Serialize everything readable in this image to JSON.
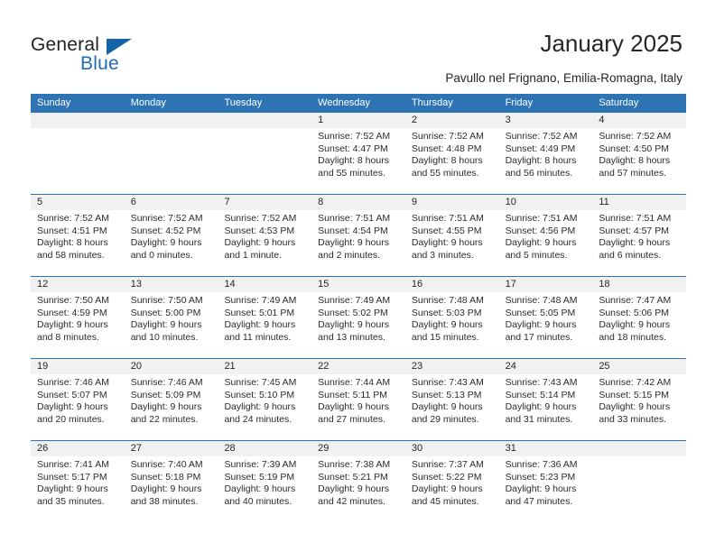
{
  "brand": {
    "name_part1": "General",
    "name_part2": "Blue",
    "accent_color": "#1464a8"
  },
  "header": {
    "title": "January 2025",
    "subtitle": "Pavullo nel Frignano, Emilia-Romagna, Italy",
    "header_bg_color": "#2e74b5"
  },
  "calendar": {
    "weekday_headers": [
      "Sunday",
      "Monday",
      "Tuesday",
      "Wednesday",
      "Thursday",
      "Friday",
      "Saturday"
    ],
    "weeks": [
      [
        {
          "day": "",
          "lines": []
        },
        {
          "day": "",
          "lines": []
        },
        {
          "day": "",
          "lines": []
        },
        {
          "day": "1",
          "lines": [
            "Sunrise: 7:52 AM",
            "Sunset: 4:47 PM",
            "Daylight: 8 hours",
            "and 55 minutes."
          ]
        },
        {
          "day": "2",
          "lines": [
            "Sunrise: 7:52 AM",
            "Sunset: 4:48 PM",
            "Daylight: 8 hours",
            "and 55 minutes."
          ]
        },
        {
          "day": "3",
          "lines": [
            "Sunrise: 7:52 AM",
            "Sunset: 4:49 PM",
            "Daylight: 8 hours",
            "and 56 minutes."
          ]
        },
        {
          "day": "4",
          "lines": [
            "Sunrise: 7:52 AM",
            "Sunset: 4:50 PM",
            "Daylight: 8 hours",
            "and 57 minutes."
          ]
        }
      ],
      [
        {
          "day": "5",
          "lines": [
            "Sunrise: 7:52 AM",
            "Sunset: 4:51 PM",
            "Daylight: 8 hours",
            "and 58 minutes."
          ]
        },
        {
          "day": "6",
          "lines": [
            "Sunrise: 7:52 AM",
            "Sunset: 4:52 PM",
            "Daylight: 9 hours",
            "and 0 minutes."
          ]
        },
        {
          "day": "7",
          "lines": [
            "Sunrise: 7:52 AM",
            "Sunset: 4:53 PM",
            "Daylight: 9 hours",
            "and 1 minute."
          ]
        },
        {
          "day": "8",
          "lines": [
            "Sunrise: 7:51 AM",
            "Sunset: 4:54 PM",
            "Daylight: 9 hours",
            "and 2 minutes."
          ]
        },
        {
          "day": "9",
          "lines": [
            "Sunrise: 7:51 AM",
            "Sunset: 4:55 PM",
            "Daylight: 9 hours",
            "and 3 minutes."
          ]
        },
        {
          "day": "10",
          "lines": [
            "Sunrise: 7:51 AM",
            "Sunset: 4:56 PM",
            "Daylight: 9 hours",
            "and 5 minutes."
          ]
        },
        {
          "day": "11",
          "lines": [
            "Sunrise: 7:51 AM",
            "Sunset: 4:57 PM",
            "Daylight: 9 hours",
            "and 6 minutes."
          ]
        }
      ],
      [
        {
          "day": "12",
          "lines": [
            "Sunrise: 7:50 AM",
            "Sunset: 4:59 PM",
            "Daylight: 9 hours",
            "and 8 minutes."
          ]
        },
        {
          "day": "13",
          "lines": [
            "Sunrise: 7:50 AM",
            "Sunset: 5:00 PM",
            "Daylight: 9 hours",
            "and 10 minutes."
          ]
        },
        {
          "day": "14",
          "lines": [
            "Sunrise: 7:49 AM",
            "Sunset: 5:01 PM",
            "Daylight: 9 hours",
            "and 11 minutes."
          ]
        },
        {
          "day": "15",
          "lines": [
            "Sunrise: 7:49 AM",
            "Sunset: 5:02 PM",
            "Daylight: 9 hours",
            "and 13 minutes."
          ]
        },
        {
          "day": "16",
          "lines": [
            "Sunrise: 7:48 AM",
            "Sunset: 5:03 PM",
            "Daylight: 9 hours",
            "and 15 minutes."
          ]
        },
        {
          "day": "17",
          "lines": [
            "Sunrise: 7:48 AM",
            "Sunset: 5:05 PM",
            "Daylight: 9 hours",
            "and 17 minutes."
          ]
        },
        {
          "day": "18",
          "lines": [
            "Sunrise: 7:47 AM",
            "Sunset: 5:06 PM",
            "Daylight: 9 hours",
            "and 18 minutes."
          ]
        }
      ],
      [
        {
          "day": "19",
          "lines": [
            "Sunrise: 7:46 AM",
            "Sunset: 5:07 PM",
            "Daylight: 9 hours",
            "and 20 minutes."
          ]
        },
        {
          "day": "20",
          "lines": [
            "Sunrise: 7:46 AM",
            "Sunset: 5:09 PM",
            "Daylight: 9 hours",
            "and 22 minutes."
          ]
        },
        {
          "day": "21",
          "lines": [
            "Sunrise: 7:45 AM",
            "Sunset: 5:10 PM",
            "Daylight: 9 hours",
            "and 24 minutes."
          ]
        },
        {
          "day": "22",
          "lines": [
            "Sunrise: 7:44 AM",
            "Sunset: 5:11 PM",
            "Daylight: 9 hours",
            "and 27 minutes."
          ]
        },
        {
          "day": "23",
          "lines": [
            "Sunrise: 7:43 AM",
            "Sunset: 5:13 PM",
            "Daylight: 9 hours",
            "and 29 minutes."
          ]
        },
        {
          "day": "24",
          "lines": [
            "Sunrise: 7:43 AM",
            "Sunset: 5:14 PM",
            "Daylight: 9 hours",
            "and 31 minutes."
          ]
        },
        {
          "day": "25",
          "lines": [
            "Sunrise: 7:42 AM",
            "Sunset: 5:15 PM",
            "Daylight: 9 hours",
            "and 33 minutes."
          ]
        }
      ],
      [
        {
          "day": "26",
          "lines": [
            "Sunrise: 7:41 AM",
            "Sunset: 5:17 PM",
            "Daylight: 9 hours",
            "and 35 minutes."
          ]
        },
        {
          "day": "27",
          "lines": [
            "Sunrise: 7:40 AM",
            "Sunset: 5:18 PM",
            "Daylight: 9 hours",
            "and 38 minutes."
          ]
        },
        {
          "day": "28",
          "lines": [
            "Sunrise: 7:39 AM",
            "Sunset: 5:19 PM",
            "Daylight: 9 hours",
            "and 40 minutes."
          ]
        },
        {
          "day": "29",
          "lines": [
            "Sunrise: 7:38 AM",
            "Sunset: 5:21 PM",
            "Daylight: 9 hours",
            "and 42 minutes."
          ]
        },
        {
          "day": "30",
          "lines": [
            "Sunrise: 7:37 AM",
            "Sunset: 5:22 PM",
            "Daylight: 9 hours",
            "and 45 minutes."
          ]
        },
        {
          "day": "31",
          "lines": [
            "Sunrise: 7:36 AM",
            "Sunset: 5:23 PM",
            "Daylight: 9 hours",
            "and 47 minutes."
          ]
        },
        {
          "day": "",
          "lines": []
        }
      ]
    ]
  }
}
